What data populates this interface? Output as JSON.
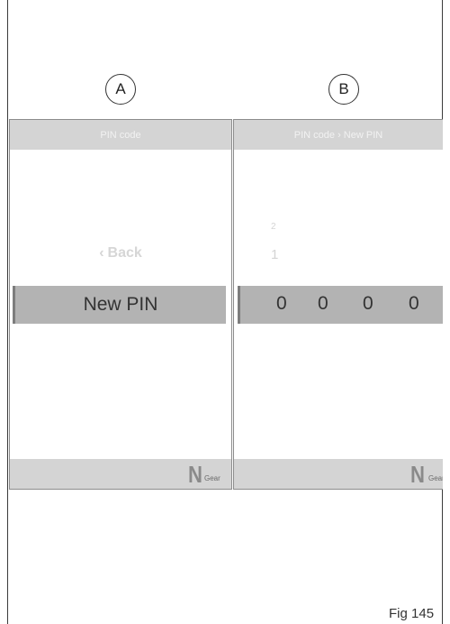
{
  "markers": {
    "a": "A",
    "b": "B"
  },
  "screen_a": {
    "header_title": "PIN code",
    "back_chevron": "‹",
    "back_label": "Back",
    "selected_label": "New PIN",
    "gear_letter": "N",
    "gear_label": "Gear"
  },
  "screen_b": {
    "header_title": "PIN code › New PIN",
    "scroll_digit_upper": "2",
    "scroll_digit_lower": "1",
    "pin_digits": [
      "0",
      "0",
      "0",
      "0"
    ],
    "gear_letter": "N",
    "gear_label": "Gear"
  },
  "figure_label": "Fig 145",
  "icons": {
    "back": "chevron-left-icon"
  },
  "colors": {
    "header_bg": "#d4d4d4",
    "selected_bg": "#b3b3b3",
    "selected_accent": "#7d7d7d"
  }
}
